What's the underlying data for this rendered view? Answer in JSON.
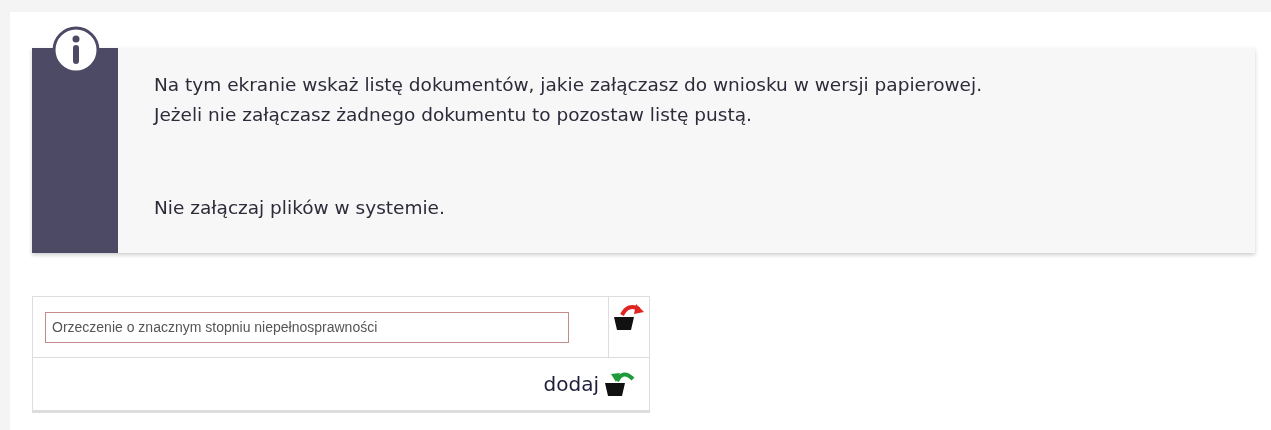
{
  "info": {
    "lines": [
      "Na tym ekranie wskaż listę dokumentów, jakie załączasz do wniosku w wersji papierowej.",
      "Jeżeli nie załączasz żadnego dokumentu to pozostaw listę pustą."
    ],
    "note": "Nie załączaj plików w systemie."
  },
  "documents": [
    {
      "value": "Orzeczenie o znacznym stopniu niepełnosprawności"
    }
  ],
  "add_label": "dodaj"
}
